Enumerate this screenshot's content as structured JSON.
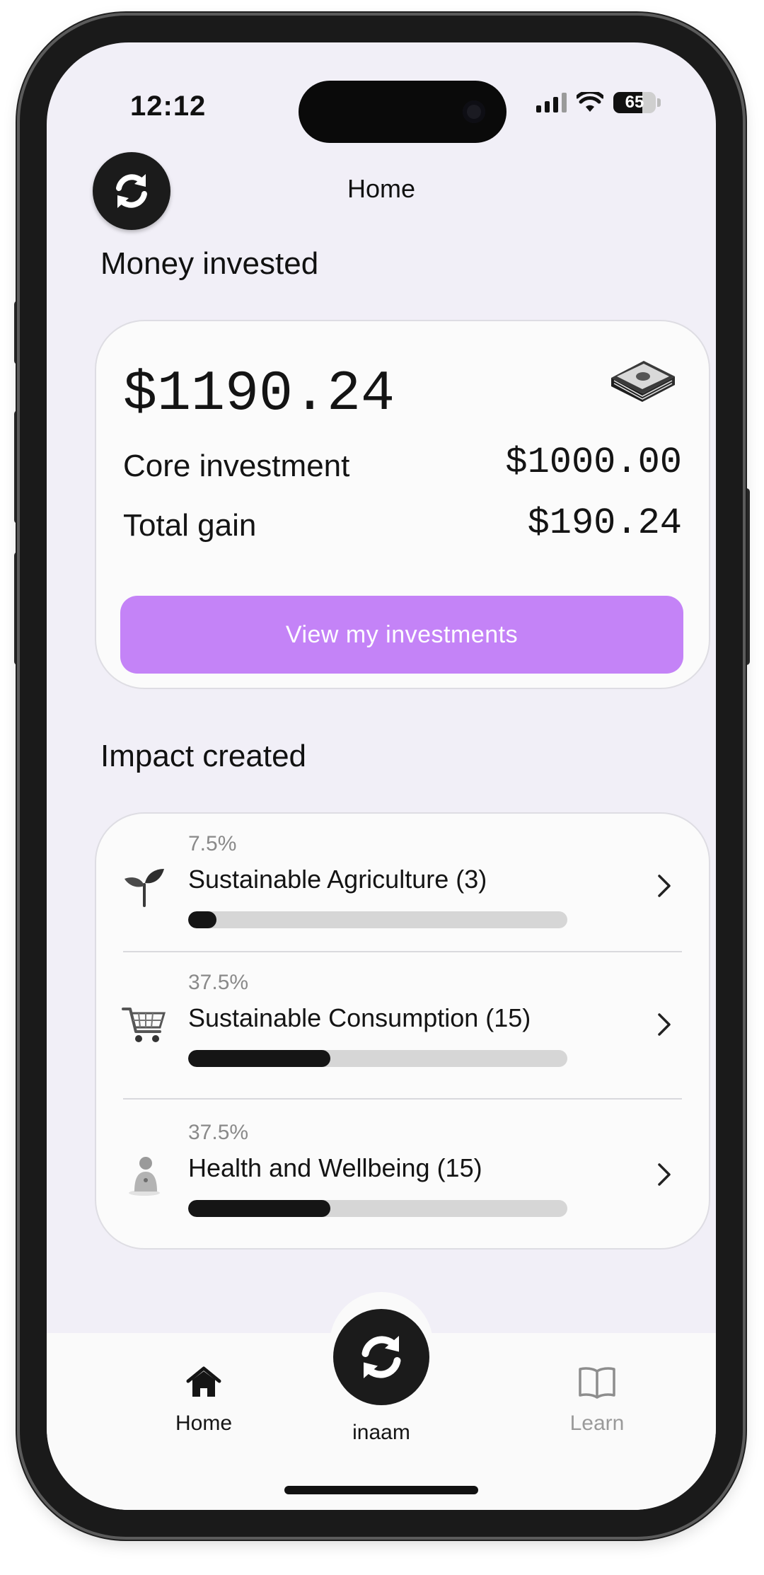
{
  "status_bar": {
    "time": "12:12",
    "battery": "65"
  },
  "header": {
    "title": "Home"
  },
  "money_section": {
    "title": "Money invested",
    "total": "$1190.24",
    "rows": [
      {
        "label": "Core investment",
        "value": "$1000.00"
      },
      {
        "label": "Total gain",
        "value": "$190.24"
      }
    ],
    "cta_label": "View my investments"
  },
  "impact_section": {
    "title": "Impact created",
    "items": [
      {
        "percent": "7.5%",
        "name": "Sustainable Agriculture (3)",
        "progress": 0.075,
        "icon": "seedling-icon"
      },
      {
        "percent": "37.5%",
        "name": "Sustainable Consumption (15)",
        "progress": 0.375,
        "icon": "shopping-cart-icon"
      },
      {
        "percent": "37.5%",
        "name": "Health and Wellbeing (15)",
        "progress": 0.375,
        "icon": "person-icon"
      }
    ]
  },
  "tabbar": {
    "tabs": [
      {
        "label": "Home",
        "icon": "home-icon",
        "active": true
      },
      {
        "label": "inaam",
        "icon": "inaam-logo-icon",
        "active": false
      },
      {
        "label": "Learn",
        "icon": "book-icon",
        "active": false
      }
    ]
  },
  "colors": {
    "accent": "#c483f7",
    "background": "#f1eff7",
    "progress": "#151515",
    "track": "#d6d6d6"
  }
}
